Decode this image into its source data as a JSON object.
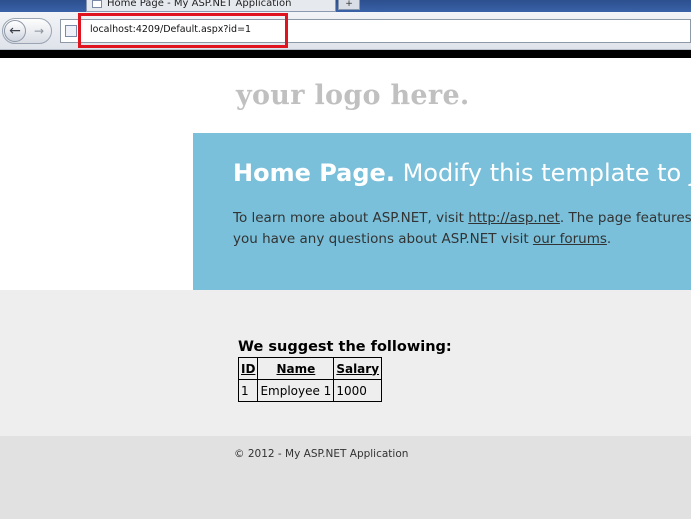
{
  "browser": {
    "tab_title": "Home Page - My ASP.NET Application",
    "url": "localhost:4209/Default.aspx?id=1",
    "back_glyph": "←",
    "forward_glyph": "→",
    "new_tab_glyph": "+",
    "highlight_color": "#e0141e"
  },
  "header": {
    "logo_text": "your logo here."
  },
  "hero": {
    "title_bold": "Home Page.",
    "title_rest": "Modify this template to jum",
    "line1_prefix": "To learn more about ASP.NET, visit",
    "line1_link": "http://asp.net",
    "line1_suffix": ". The page features",
    "line2_prefix": "you have any questions about ASP.NET visit",
    "line2_link": "our forums",
    "line2_suffix": ".",
    "background_color": "#7ac0da"
  },
  "main": {
    "heading": "We suggest the following:",
    "columns": [
      "ID",
      "Name",
      "Salary"
    ],
    "rows": [
      [
        "1",
        "Employee 1",
        "1000"
      ]
    ]
  },
  "footer": {
    "copyright": "© 2012 - My ASP.NET Application"
  }
}
